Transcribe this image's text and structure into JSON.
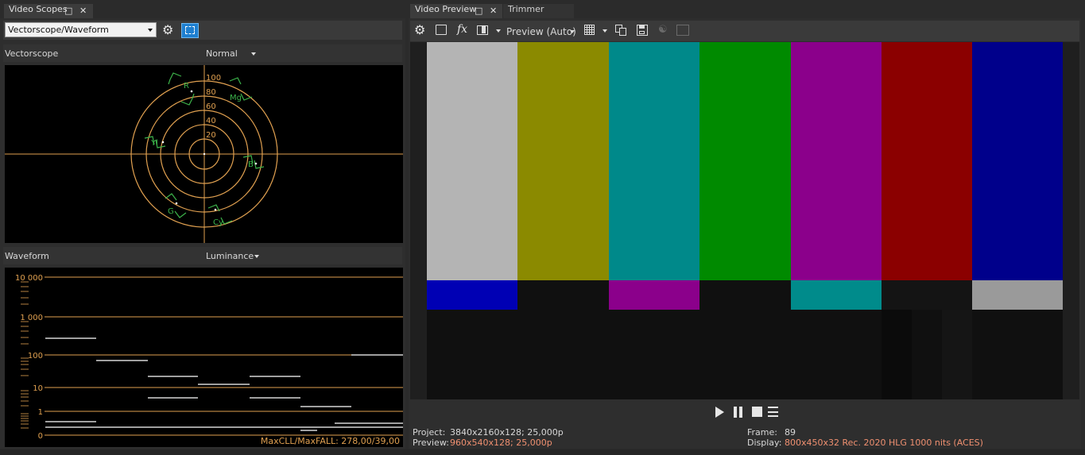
{
  "left": {
    "tab_title": "Video Scopes",
    "scope_select": "Vectorscope/Waveform",
    "vector": {
      "title": "Vectorscope",
      "mode": "Normal",
      "rings": [
        "100",
        "80",
        "60",
        "40",
        "20"
      ],
      "targets": [
        "R",
        "Mg",
        "Yl",
        "B",
        "G",
        "Cy"
      ]
    },
    "wave": {
      "title": "Waveform",
      "mode": "Luminance",
      "ticks": [
        "10 000",
        "1 000",
        "100",
        "10",
        "1",
        "0"
      ],
      "maxcll": "MaxCLL/MaxFALL: 278,00/39,00"
    }
  },
  "right": {
    "tab_preview": "Video Preview",
    "tab_trimmer": "Trimmer",
    "preview_quality": "Preview (Auto)",
    "info": {
      "project_label": "Project:",
      "project_value": "3840x2160x128; 25,000p",
      "preview_label": "Preview:",
      "preview_value": "960x540x128; 25,000p",
      "frame_label": "Frame:",
      "frame_value": "89",
      "display_label": "Display:",
      "display_value": "800x450x32 Rec. 2020 HLG 1000 nits (ACES)"
    }
  },
  "colors": {
    "accent": "#e0a050",
    "bars_top": [
      "#b4b4b4",
      "#8b8a00",
      "#00898a",
      "#008a00",
      "#8b008b",
      "#8b0000",
      "#00008b"
    ],
    "bars_mid": [
      "#0000b4",
      "#101010",
      "#8b008b",
      "#101010",
      "#008b8b",
      "#101010",
      "#9a9a9a"
    ]
  }
}
